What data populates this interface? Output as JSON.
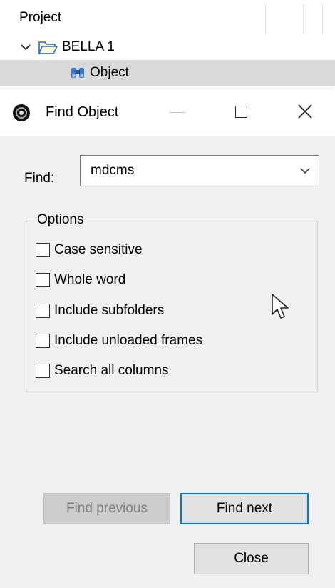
{
  "project_panel": {
    "title": "Project",
    "items": [
      {
        "label": "BELLA 1",
        "icon": "folder-open-icon",
        "expanded": true
      },
      {
        "label": "Object",
        "icon": "binoculars-icon",
        "selected": true
      }
    ]
  },
  "dialog": {
    "title": "Find Object",
    "app_icon": "record-disc-icon",
    "find": {
      "label": "Find:",
      "value": "mdcms"
    },
    "options": {
      "legend": "Options",
      "items": [
        {
          "label": "Case sensitive",
          "checked": false
        },
        {
          "label": "Whole word",
          "checked": false
        },
        {
          "label": "Include subfolders",
          "checked": false
        },
        {
          "label": "Include unloaded frames",
          "checked": false
        },
        {
          "label": "Search all columns",
          "checked": false
        }
      ]
    },
    "buttons": {
      "find_previous": "Find previous",
      "find_next": "Find next",
      "close": "Close"
    }
  },
  "colors": {
    "dialog_bg": "#f0f0f0",
    "selection_bg": "#d9d9d9",
    "accent_border": "#0078d7",
    "disabled_text": "#7d7d7d"
  }
}
